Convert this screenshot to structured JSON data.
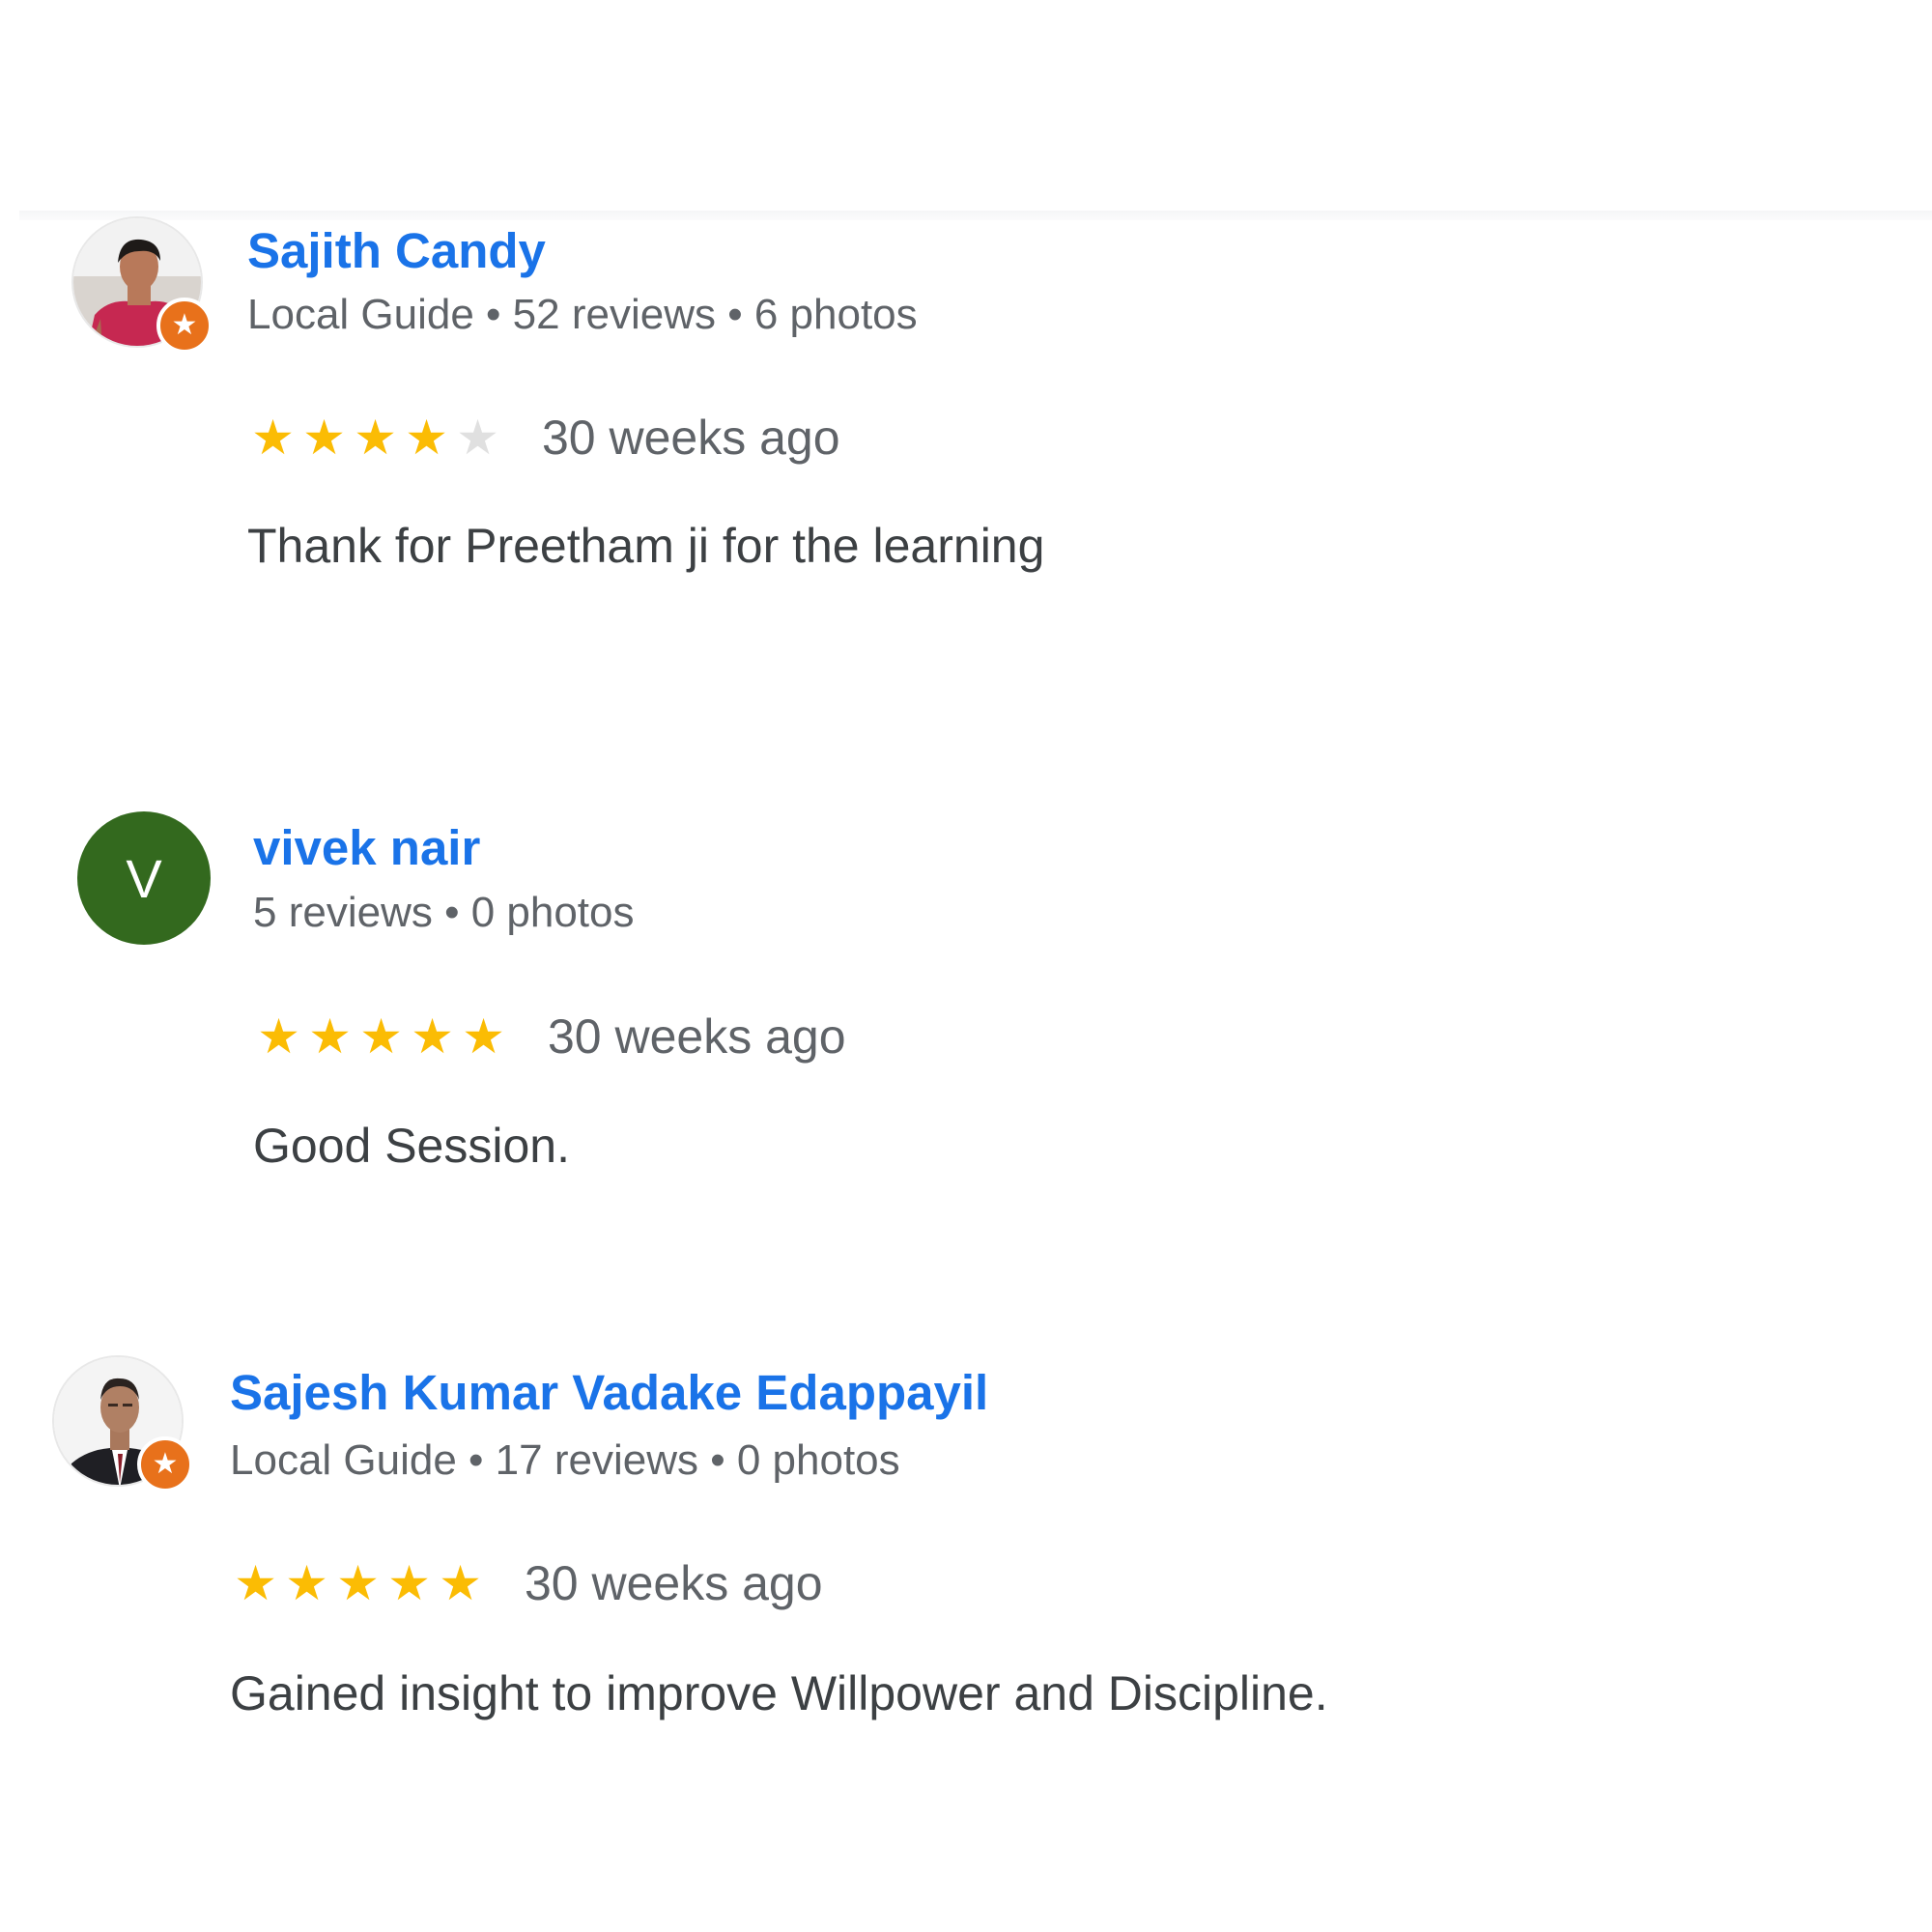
{
  "reviews": [
    {
      "name": "Sajith Candy",
      "meta": "Local Guide • 52 reviews • 6 photos",
      "rating": 4,
      "rating_max": 5,
      "time": "30 weeks ago",
      "text": "Thank for Preetham ji for the learning",
      "avatar_type": "photo",
      "local_guide_badge": true
    },
    {
      "name": "vivek nair",
      "meta": "5 reviews • 0 photos",
      "rating": 5,
      "rating_max": 5,
      "time": "30 weeks ago",
      "text": "Good Session.",
      "avatar_type": "letter",
      "avatar_letter": "V",
      "avatar_color": "#33691e",
      "local_guide_badge": false
    },
    {
      "name": "Sajesh Kumar Vadake Edappayil",
      "meta": "Local Guide • 17 reviews • 0 photos",
      "rating": 5,
      "rating_max": 5,
      "time": "30 weeks ago",
      "text": "Gained insight to improve Willpower and Discipline.",
      "avatar_type": "photo",
      "local_guide_badge": true
    }
  ],
  "colors": {
    "name_link": "#1a73e8",
    "star_on": "#fbbc04",
    "star_off": "#e0e0e0",
    "local_guide_badge": "#e8711b",
    "meta_text": "#5f6368"
  },
  "icons": {
    "star": "star-icon",
    "local_guide": "local-guide-badge-icon"
  }
}
